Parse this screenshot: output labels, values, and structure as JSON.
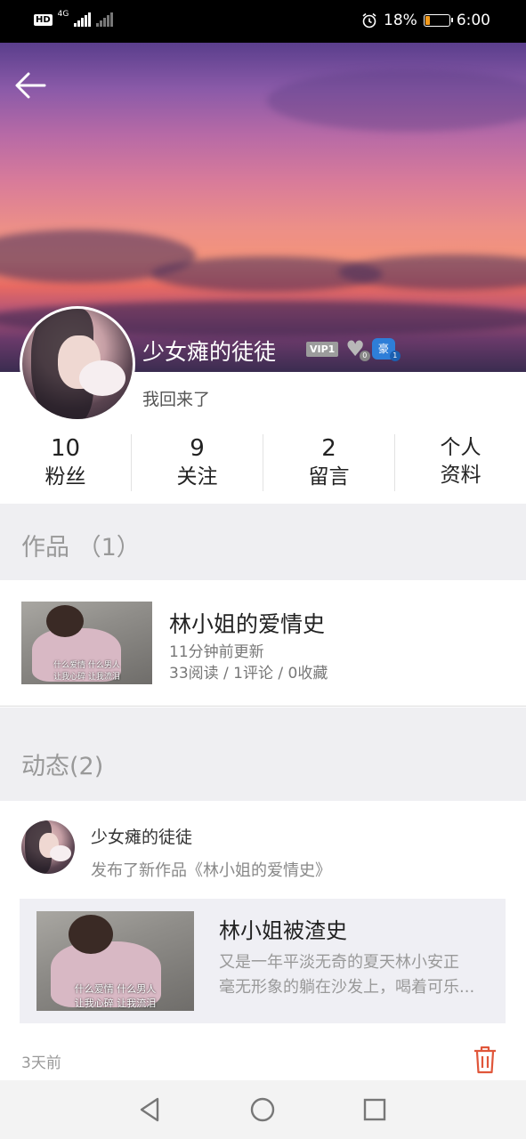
{
  "status_bar": {
    "network_badge": "HD",
    "network_type": "4G",
    "battery_text": "18%",
    "battery_level": 0.18,
    "time": "6:00",
    "icons": [
      "signal-icon",
      "alarm-icon",
      "battery-icon"
    ]
  },
  "profile": {
    "username": "少女瘫的徒徒",
    "vip_badge": "VIP1",
    "heart_badge_count": "0",
    "rich_badge_label": "豪",
    "rich_badge_count": "1",
    "bio": "我回来了"
  },
  "stats": [
    {
      "value": "10",
      "label": "粉丝"
    },
    {
      "value": "9",
      "label": "关注"
    },
    {
      "value": "2",
      "label": "留言"
    }
  ],
  "profile_info": {
    "line1": "个人",
    "line2": "资料"
  },
  "works_section": {
    "title": "作品 （1）",
    "items": [
      {
        "title": "林小姐的爱情史",
        "updated": "11分钟前更新",
        "stats": "33阅读 / 1评论 / 0收藏",
        "thumb_caption_line1": "什么爱情 什么男人",
        "thumb_caption_line2": "让我心碎 让我流泪"
      }
    ]
  },
  "feed_section": {
    "title": "动态(2)",
    "items": [
      {
        "author": "少女瘫的徒徒",
        "action": "发布了新作品《林小姐的爱情史》",
        "card_title": "林小姐被渣史",
        "card_text_line1": "又是一年平淡无奇的夏天林小安正",
        "card_text_line2": "毫无形象的躺在沙发上，喝着可乐...",
        "thumb_caption_line1": "什么爱情 什么男人",
        "thumb_caption_line2": "让我心碎 让我流泪",
        "time": "3天前"
      }
    ]
  },
  "colors": {
    "accent_delete": "#e0563a",
    "section_bg": "#efeff2",
    "vip_badge": "#9c9c9c",
    "rich_badge": "#2e7ed8"
  }
}
